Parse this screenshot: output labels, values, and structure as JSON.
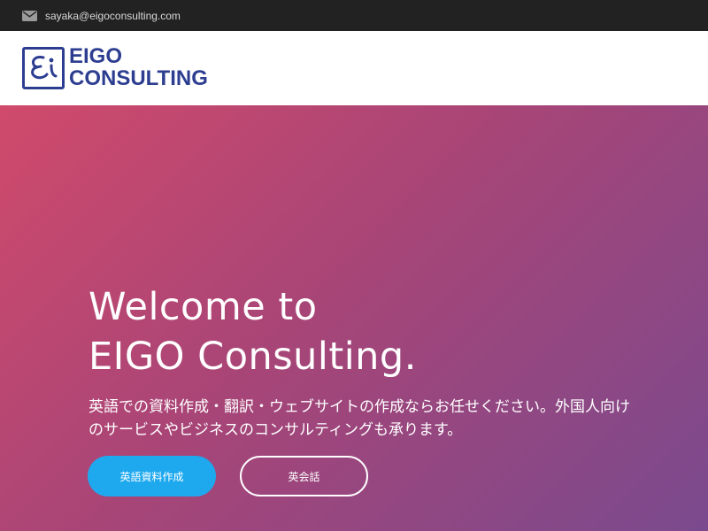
{
  "topbar": {
    "email": "sayaka@eigoconsulting.com",
    "icon": "envelope-icon"
  },
  "brand": {
    "line1": "EIGO",
    "line2": "CONSULTING",
    "mark_text": "Ei",
    "color": "#2d3e91"
  },
  "hero": {
    "title_line1": "Welcome to",
    "title_line2": "EIGO Consulting.",
    "description": "英語での資料作成・翻訳・ウェブサイトの作成ならお任せください。外国人向けのサービスやビジネスのコンサルティングも承ります。",
    "gradient": [
      "#d04a6b",
      "#a84577",
      "#7a4a8e"
    ]
  },
  "buttons": {
    "primary_label": "英語資料作成",
    "secondary_label": "英会話",
    "primary_color": "#1ea9ef"
  }
}
